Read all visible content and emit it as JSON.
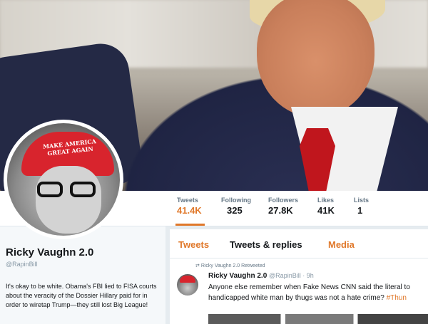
{
  "profile": {
    "name": "Ricky Vaughn 2.0",
    "handle": "@RapinBill",
    "bio": "It's okay to be white. Obama's FBI lied to FISA courts about the veracity of the Dossier Hillary paid for in order to wiretap Trump—they still lost Big League!",
    "avatar_cap_text": "MAKE AMERICA GREAT AGAIN"
  },
  "stats": [
    {
      "label": "Tweets",
      "value": "41.4K"
    },
    {
      "label": "Following",
      "value": "325"
    },
    {
      "label": "Followers",
      "value": "27.8K"
    },
    {
      "label": "Likes",
      "value": "41K"
    },
    {
      "label": "Lists",
      "value": "1"
    }
  ],
  "tabs": [
    {
      "label": "Tweets"
    },
    {
      "label": "Tweets & replies"
    },
    {
      "label": "Media"
    }
  ],
  "tweet": {
    "retweet_note": "Ricky Vaughn 2.0 Retweeted",
    "author_name": "Ricky Vaughn 2.0",
    "author_handle": "@RapinBill · 9h",
    "line1": "Anyone else remember when Fake News CNN said the literal to",
    "line2": "handicapped white man by thugs was not a hate crime?",
    "hashtag": "#Thun"
  },
  "colors": {
    "accent": "#e0782a",
    "background": "#e6ecf0"
  }
}
